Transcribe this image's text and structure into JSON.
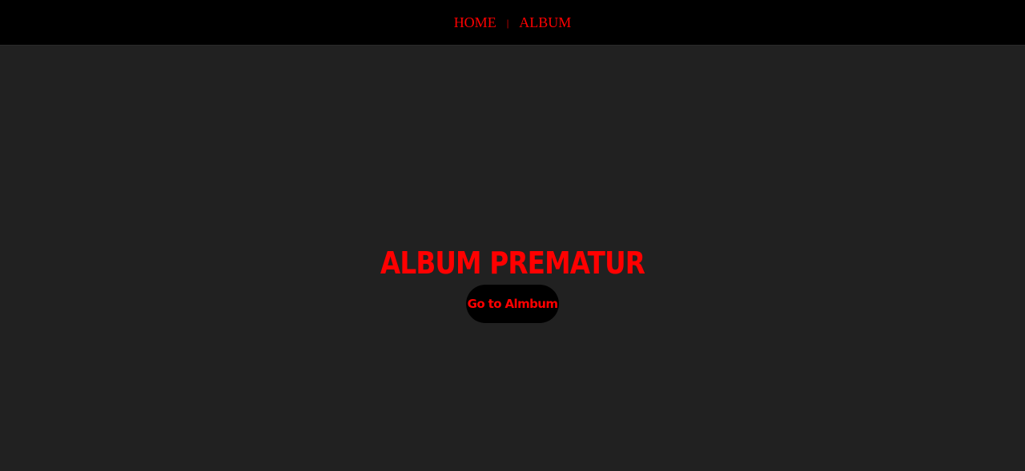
{
  "nav": {
    "items": [
      {
        "label": "HOME"
      },
      {
        "label": "ALBUM"
      }
    ],
    "separator": "|"
  },
  "hero": {
    "title": "ALBUM PREMATUR",
    "button_label": "Go to Almbum"
  },
  "colors": {
    "accent": "#ff0000",
    "navbar_background": "#000000",
    "page_background": "#212121",
    "button_background": "#000000"
  }
}
